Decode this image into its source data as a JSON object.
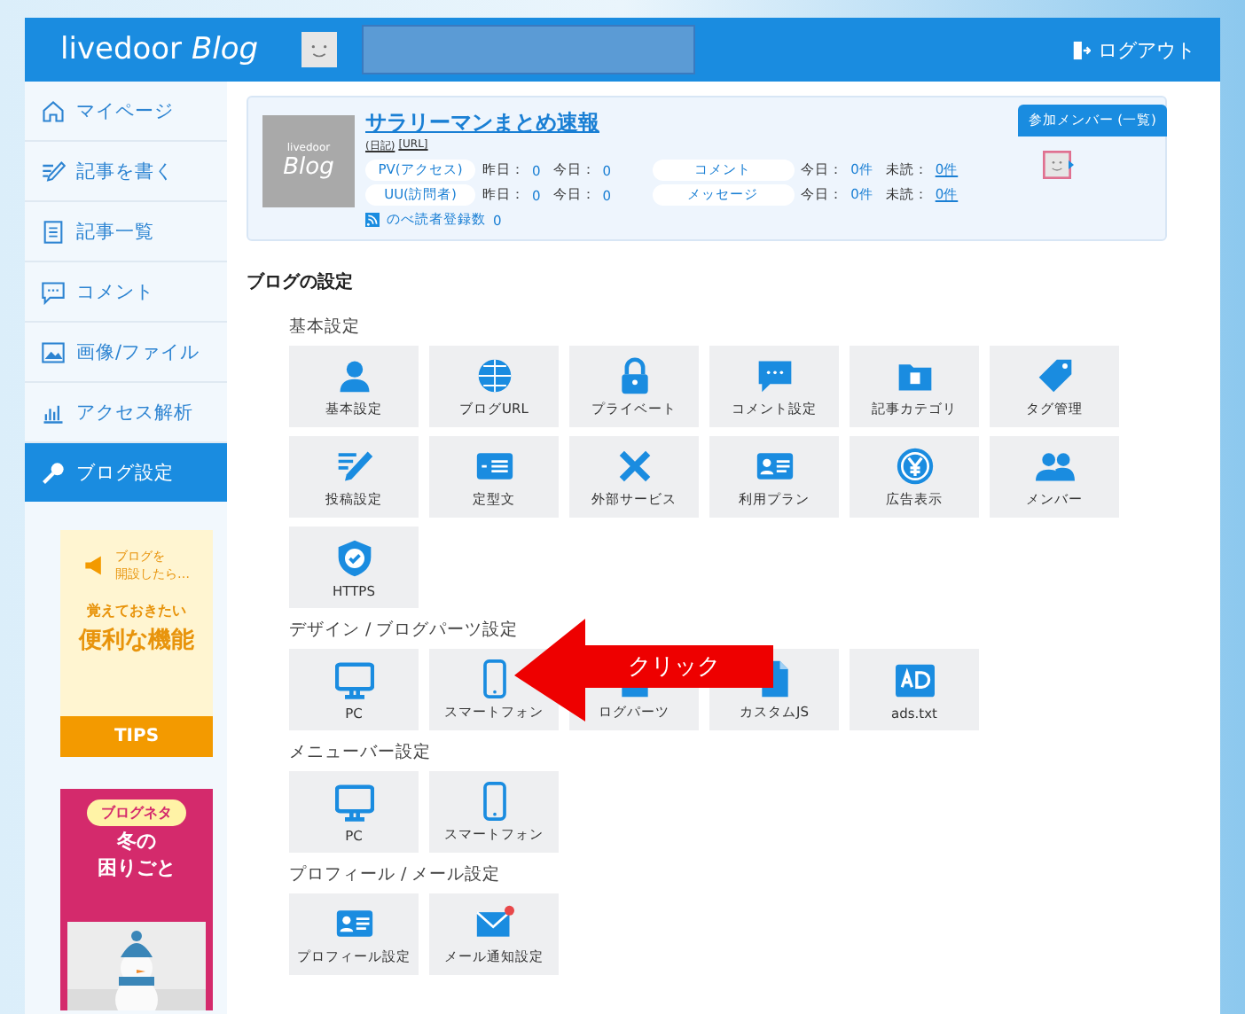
{
  "header": {
    "logo": "livedoor *Blog*",
    "logout": "ログアウト"
  },
  "sidebar": {
    "items": [
      {
        "label": "マイページ",
        "selected": false
      },
      {
        "label": "記事を書く",
        "selected": false
      },
      {
        "label": "記事一覧",
        "selected": false
      },
      {
        "label": "コメント",
        "selected": false
      },
      {
        "label": "画像/ファイル",
        "selected": false
      },
      {
        "label": "アクセス解析",
        "selected": false
      },
      {
        "label": "ブログ設定",
        "selected": true
      }
    ],
    "banners": [
      {
        "kind": "tips",
        "lines": [
          "ブログを",
          "開設したら…"
        ],
        "sub": "覚えておきたい",
        "title": "便利な機能",
        "footer": "TIPS"
      },
      {
        "kind": "neta",
        "tag": "ブログネタ",
        "title_lines": [
          "冬の",
          "困りごと"
        ]
      }
    ]
  },
  "blog": {
    "thumb": [
      "livedoor",
      "Blog"
    ],
    "title": "サラリーマンまとめ速報",
    "links": [
      "(日記)",
      "[URL]"
    ],
    "stats": [
      {
        "label": "PV(アクセス)",
        "items": [
          {
            "key": "昨日：",
            "value": "0",
            "link": false
          },
          {
            "key": "今日：",
            "value": "0",
            "link": false
          }
        ]
      },
      {
        "label": "UU(訪問者)",
        "items": [
          {
            "key": "昨日：",
            "value": "0",
            "link": false
          },
          {
            "key": "今日：",
            "value": "0",
            "link": false
          }
        ]
      }
    ],
    "messages": [
      {
        "label": "コメント",
        "items": [
          {
            "key": "今日：",
            "value": "0件",
            "link": false
          },
          {
            "key": "未読：",
            "value": "0件",
            "link": true
          }
        ]
      },
      {
        "label": "メッセージ",
        "items": [
          {
            "key": "今日：",
            "value": "0件",
            "link": false
          },
          {
            "key": "未読：",
            "value": "0件",
            "link": true
          }
        ]
      }
    ],
    "readers": {
      "label": "のべ読者登録数",
      "value": "0"
    },
    "members_button": "参加メンバー (一覧)"
  },
  "settings": {
    "title": "ブログの設定",
    "sections": [
      {
        "title": "基本設定",
        "tiles": [
          "基本設定",
          "ブログURL",
          "プライベート",
          "コメント設定",
          "記事カテゴリ",
          "タグ管理",
          "投稿設定",
          "定型文",
          "外部サービス",
          "利用プラン",
          "広告表示",
          "メンバー",
          "HTTPS"
        ]
      },
      {
        "title": "デザイン / ブログパーツ設定",
        "tiles": [
          "PC",
          "スマートフォン",
          "ログパーツ",
          "カスタムJS",
          "ads.txt"
        ]
      },
      {
        "title": "メニューバー設定",
        "tiles": [
          "PC",
          "スマートフォン"
        ]
      },
      {
        "title": "プロフィール / メール設定",
        "tiles": [
          "プロフィール設定",
          "メール通知設定"
        ]
      }
    ]
  },
  "annotation": {
    "text": "クリック"
  }
}
